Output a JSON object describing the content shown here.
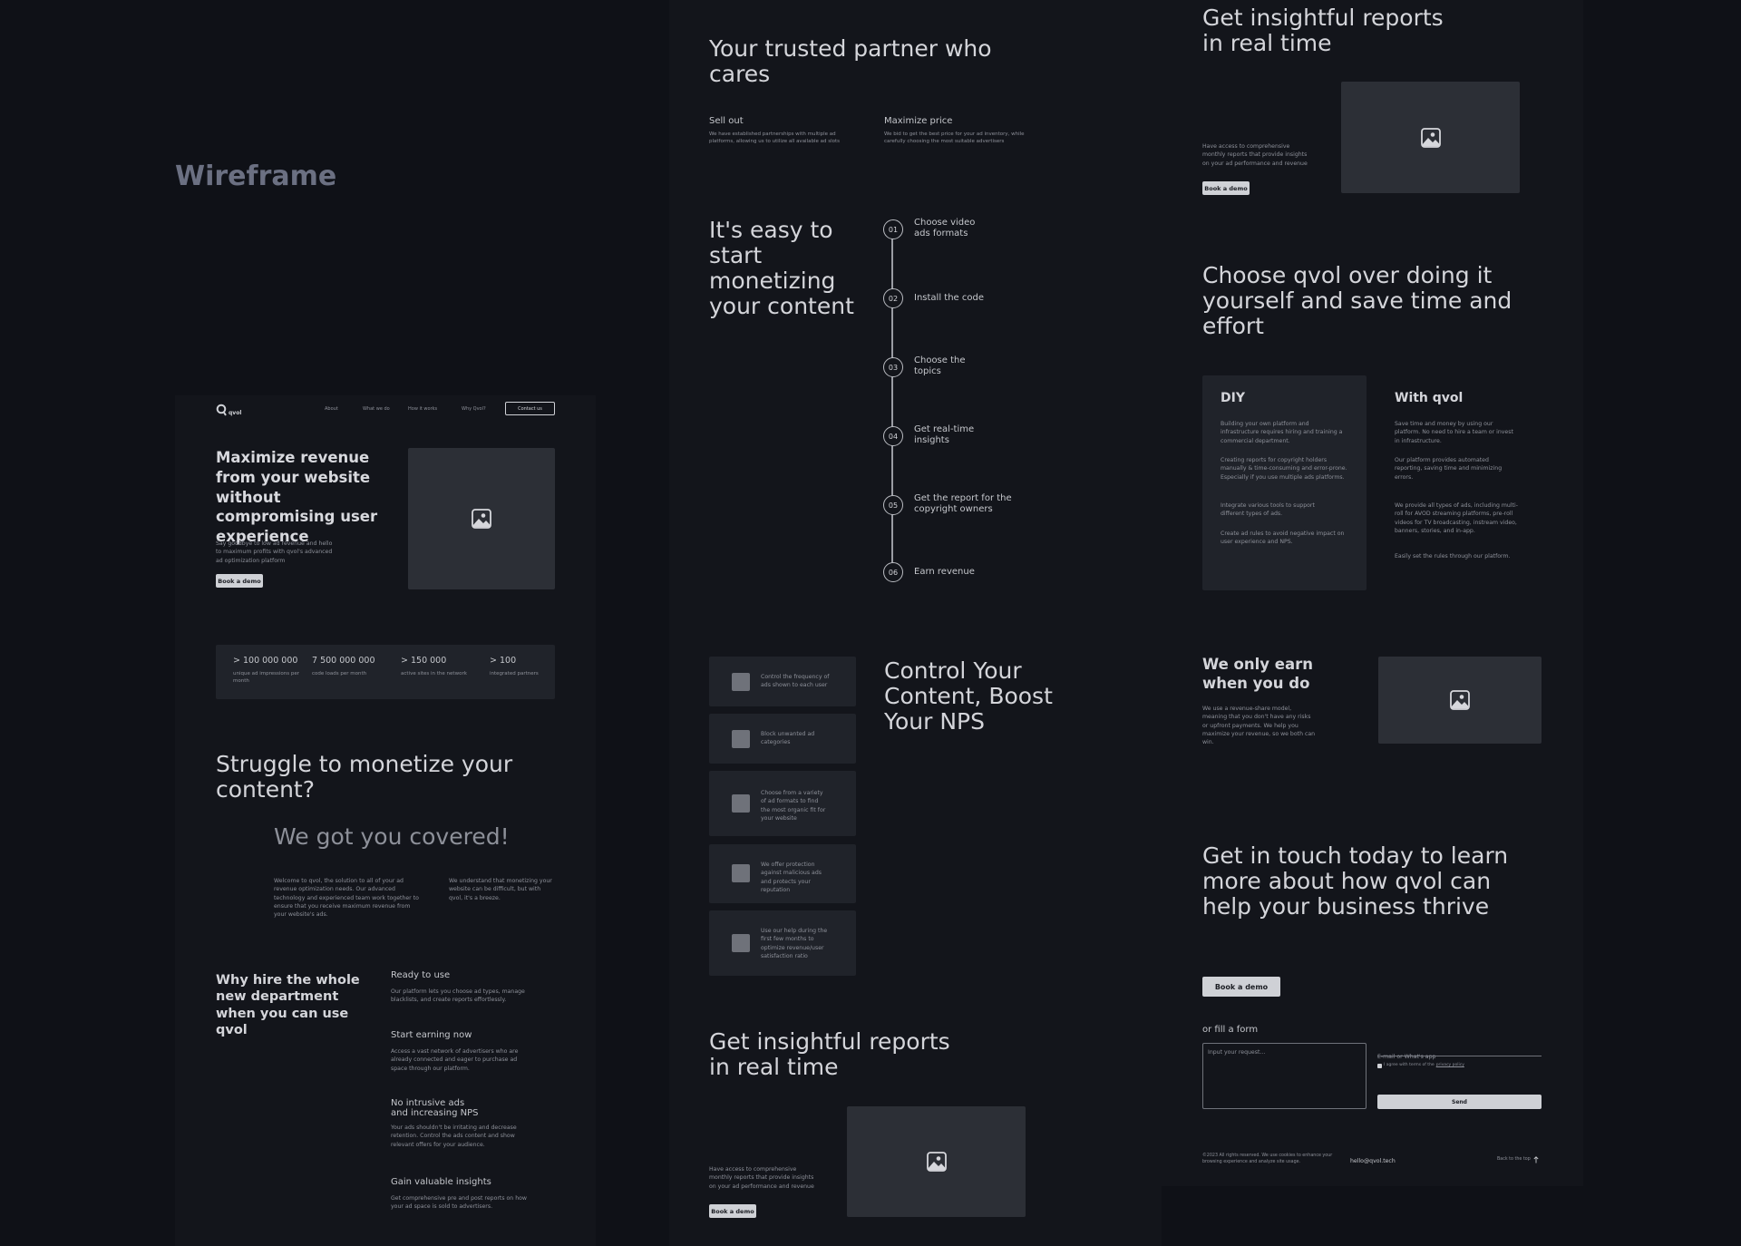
{
  "canvas_title": "Wireframe",
  "frame1": {
    "nav": {
      "logo": "qvol",
      "links": [
        "About",
        "What we do",
        "How it works",
        "Why Qvol?"
      ],
      "contact": "Contact us"
    },
    "hero": {
      "title": "Maximize revenue from your website without compromising user experience",
      "text": "Say goodbye to low ad revenue and hello to maximum profits with qvol's advanced ad optimization platform",
      "button": "Book a demo"
    },
    "stats": [
      {
        "value": "> 100 000 000",
        "label": "unique ad impressions per month"
      },
      {
        "value": "7 500 000 000",
        "label": "code loads per month"
      },
      {
        "value": "> 150 000",
        "label": "active sites in the network"
      },
      {
        "value": "> 100",
        "label": "integrated partners"
      }
    ],
    "struggle": {
      "title": "Struggle to monetize your content?",
      "subtitle": "We got you covered!",
      "col1": "Welcome to qvol, the solution to all of your ad revenue optimization needs. Our advanced technology and experienced team work together to ensure that you receive maximum revenue from your website's ads.",
      "col2": "We understand that monetizing your website can be difficult, but with qvol, it's a breeze."
    },
    "why": {
      "title": "Why hire the whole new department when you can use qvol",
      "items": [
        {
          "title": "Ready to use",
          "text": "Our platform lets you choose ad types, manage blacklists, and create reports effortlessly."
        },
        {
          "title": "Start earning now",
          "text": "Access a vast network of advertisers who are already connected and eager to purchase ad space through our platform."
        },
        {
          "title": "No intrusive ads and increasing NPS",
          "text": "Your ads shouldn't be irritating and decrease retention. Control the ads content and show relevant offers for your audience."
        },
        {
          "title": "Gain valuable insights",
          "text": "Get comprehensive pre and post reports on how your ad space is sold to advertisers."
        }
      ]
    }
  },
  "frame2": {
    "partner": {
      "title": "Your trusted partner who cares",
      "items": [
        {
          "title": "Sell out",
          "text": "We have established partnerships with multiple ad platforms, allowing us to utilize all available ad slots"
        },
        {
          "title": "Maximize price",
          "text": "We bid to get the best price for your ad inventory, while carefully choosing the most suitable advertisers"
        }
      ]
    },
    "easy": {
      "title": "It's easy to start monetizing your content",
      "steps": [
        {
          "num": "01",
          "label": "Choose video ads formats"
        },
        {
          "num": "02",
          "label": "Install the code"
        },
        {
          "num": "03",
          "label": "Choose the topics"
        },
        {
          "num": "04",
          "label": "Get real-time insights"
        },
        {
          "num": "05",
          "label": "Get the report for the copyright owners"
        },
        {
          "num": "06",
          "label": "Earn revenue"
        }
      ]
    },
    "control": {
      "title": "Control Your Content, Boost Your NPS",
      "cards": [
        "Control the frequency of ads shown to each user",
        "Block unwanted ad categories",
        "Choose from a variety of ad formats to find the most organic fit for your website",
        "We offer protection against malicious ads and protects your reputation",
        "Use our help during the first few months to optimize revenue/user satisfaction ratio"
      ]
    },
    "reports": {
      "title": "Get insightful reports in real time",
      "text": "Have access to comprehensive monthly reports that provide insights on your ad performance and revenue",
      "button": "Book a demo"
    }
  },
  "frame3": {
    "reports": {
      "title": "Get insightful reports in real time",
      "text": "Have access to comprehensive monthly reports that provide insights on your ad performance and revenue",
      "button": "Book a demo"
    },
    "choose": {
      "title": "Choose qvol over doing it yourself and save time and effort",
      "diy_title": "DIY",
      "diy_items": [
        "Building your own platform and infrastructure requires hiring and training a commercial department.",
        "Creating reports for copyright holders manually & time-consuming and error-prone. Especially if you use multiple ads platforms.",
        "Integrate various tools to support different types of ads.",
        "Create ad rules to avoid negative impact on user experience and NPS."
      ],
      "qvol_title": "With qvol",
      "qvol_items": [
        "Save time and money by using our platform. No need to hire a team or invest in infrastructure.",
        "Our platform provides automated reporting, saving time and minimizing errors.",
        "We provide all types of ads, including multi-roll for AVOD streaming platforms, pre-roll videos for TV broadcasting, instream video, banners, stories, and in-app.",
        "Easily set the rules through our platform."
      ]
    },
    "earn": {
      "title": "We only earn when you do",
      "text": "We use a revenue-share model, meaning that you don't have any risks or upfront payments. We help you maximize your revenue, so we both can win."
    },
    "touch": {
      "title": "Get in touch today to learn more about how qvol can help your business thrive",
      "button": "Book a demo",
      "or_form": "or fill a form",
      "request_placeholder": "Input your request...",
      "email_label": "E-mail or What's app",
      "agree": "I agree with terms of the",
      "agree_link": "privacy policy",
      "send": "Send"
    },
    "footer": {
      "copyright": "©2023 All rights reserved. We use cookies to enhance your browsing experience and analyze site usage.",
      "email": "hello@qvol.tech",
      "back": "Back to the top"
    }
  },
  "colors": {
    "background": "#0f1117",
    "frame": "#13151b",
    "card": "#20232a",
    "placeholder": "#2c2f36",
    "button": "#cfd1d6"
  }
}
